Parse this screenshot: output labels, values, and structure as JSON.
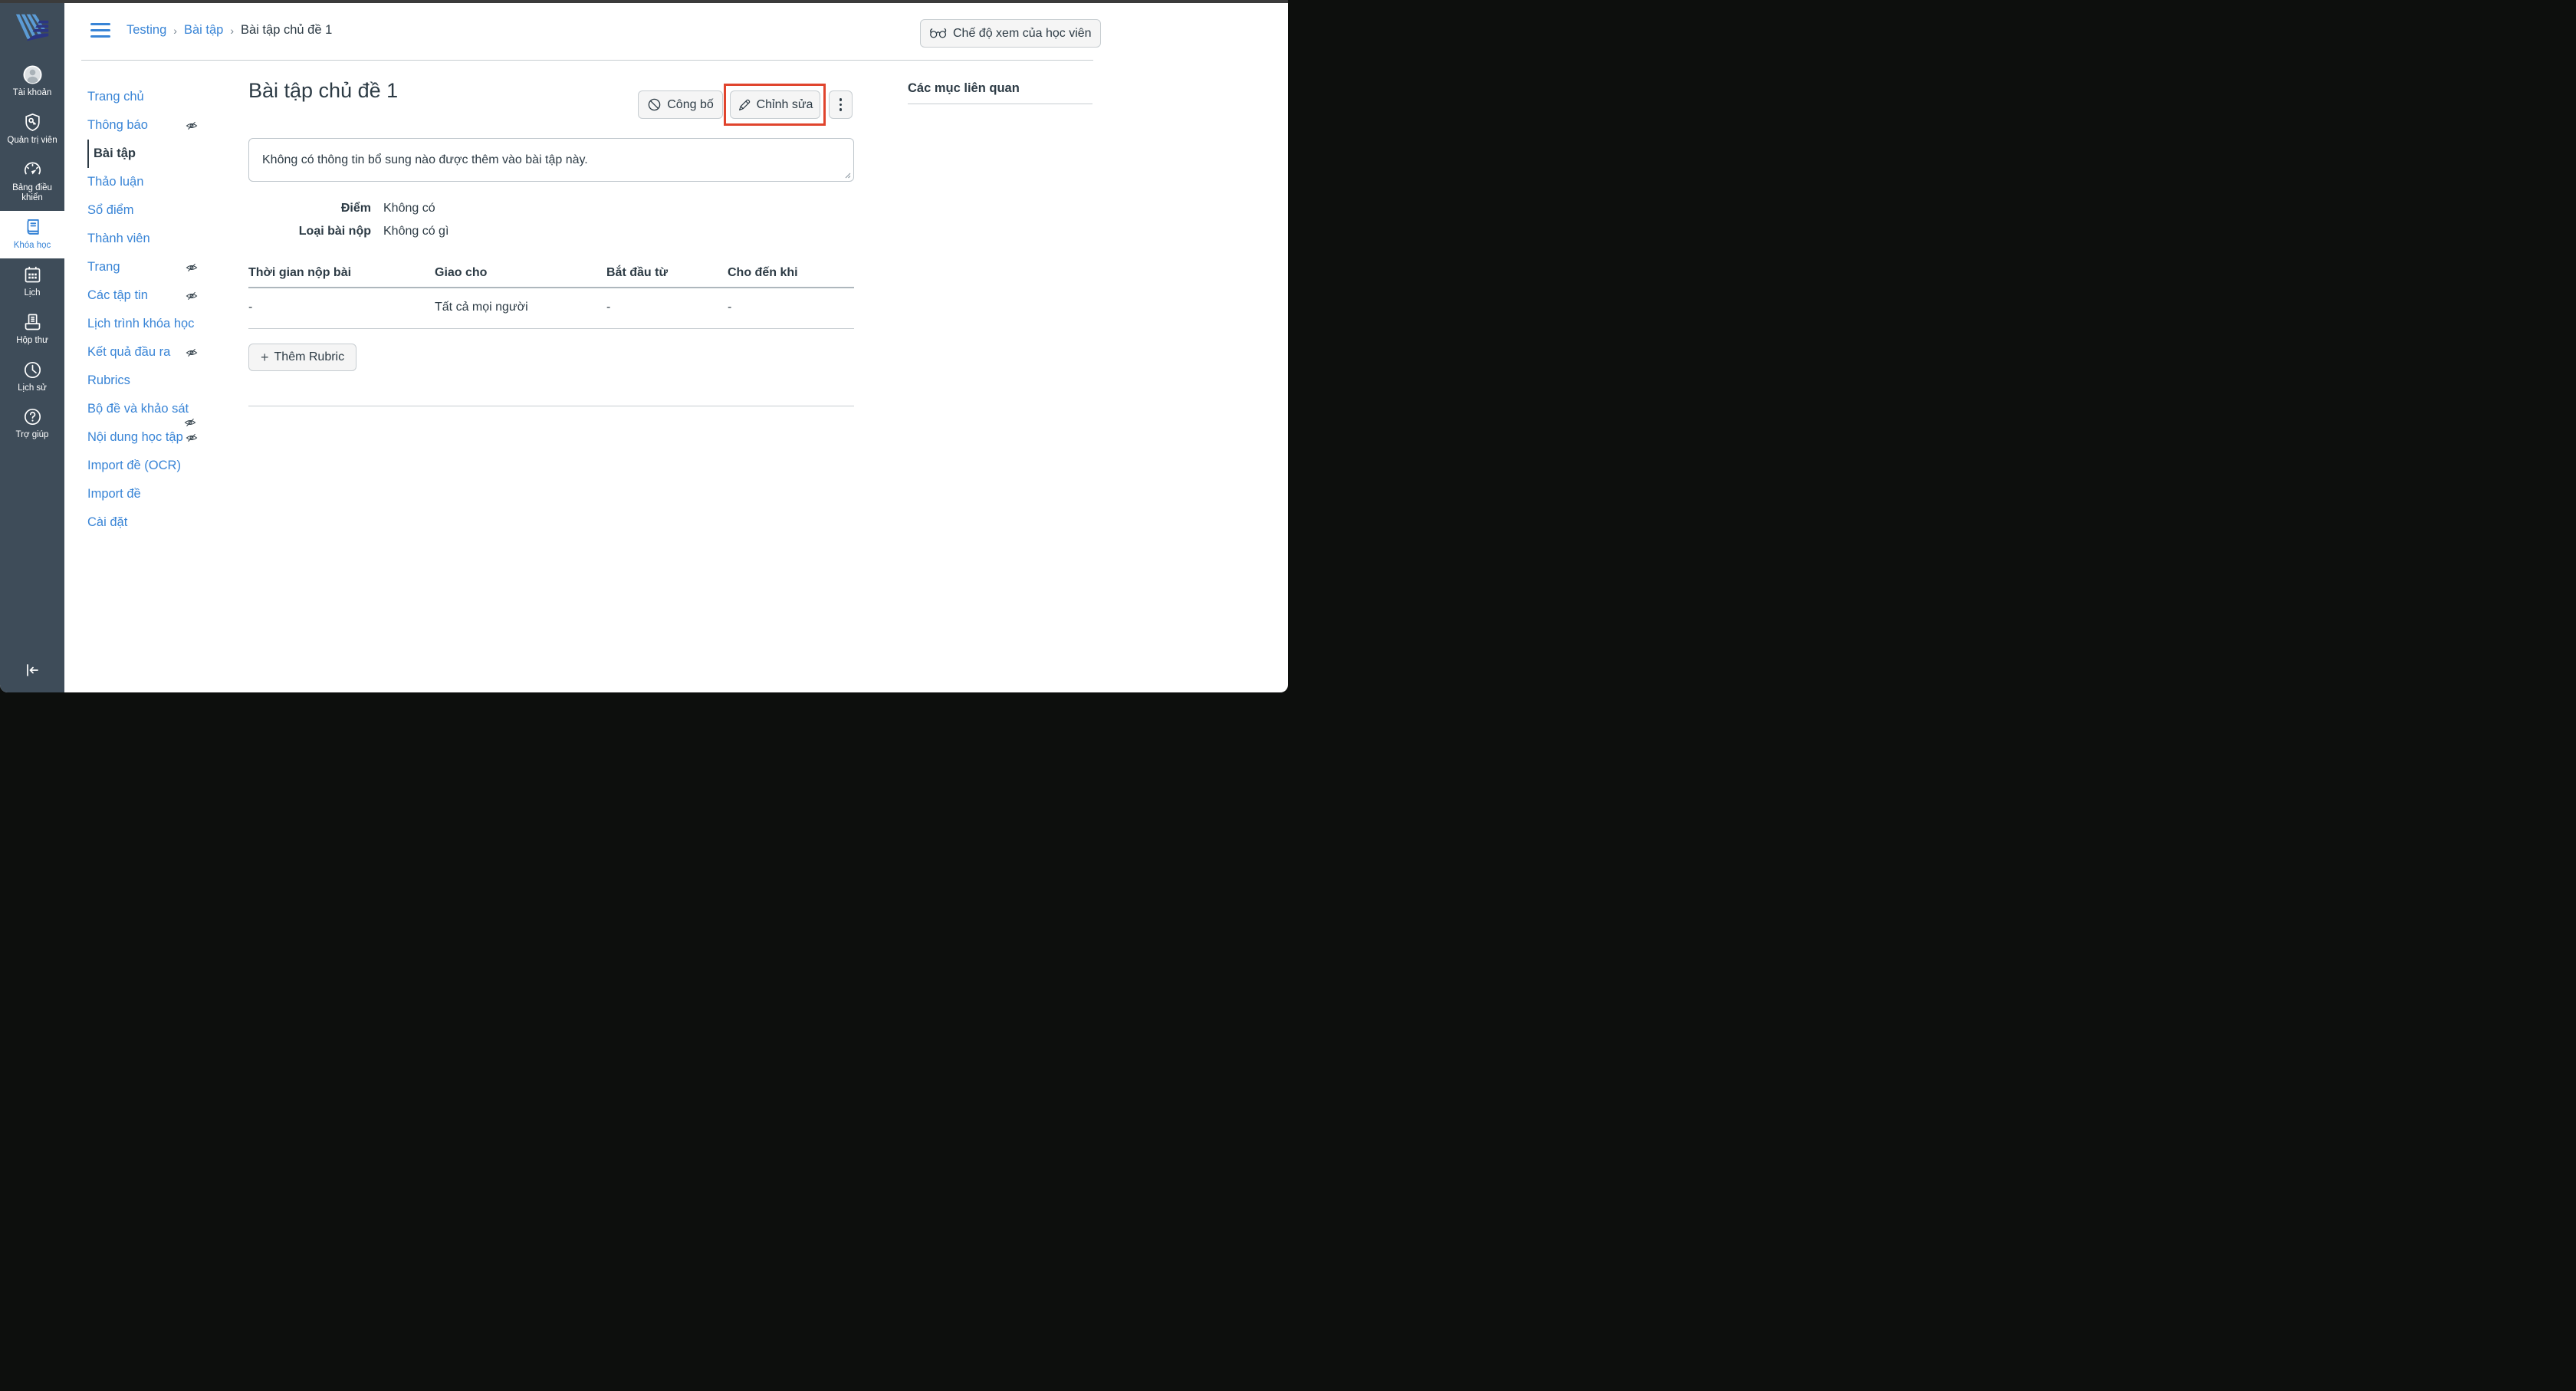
{
  "colors": {
    "accent_blue": "#3884D6",
    "slate": "#2D3B45",
    "sidebar_bg": "#3E4C59",
    "highlight_red": "#E0442D",
    "border_gray": "#C7CDD1"
  },
  "global_nav": {
    "items": [
      {
        "label": "Tài khoản",
        "icon": "avatar"
      },
      {
        "label": "Quản trị viên",
        "icon": "shield-key"
      },
      {
        "label": "Bảng điều khiển",
        "icon": "dashboard-gauge"
      },
      {
        "label": "Khóa học",
        "icon": "book",
        "active": true
      },
      {
        "label": "Lịch",
        "icon": "calendar"
      },
      {
        "label": "Hộp thư",
        "icon": "inbox"
      },
      {
        "label": "Lịch sử",
        "icon": "history-clock"
      },
      {
        "label": "Trợ giúp",
        "icon": "help-circle"
      }
    ],
    "collapse_icon": "collapse-arrow-left"
  },
  "breadcrumb": {
    "items": [
      "Testing",
      "Bài tập",
      "Bài tập chủ đề 1"
    ],
    "separator": "›"
  },
  "header": {
    "student_view_label": "Chế độ xem của học viên",
    "student_view_icon": "glasses"
  },
  "course_nav": {
    "items": [
      {
        "label": "Trang chủ"
      },
      {
        "label": "Thông báo",
        "hidden": true
      },
      {
        "label": "Bài tập",
        "active": true
      },
      {
        "label": "Thảo luận"
      },
      {
        "label": "Sổ điểm"
      },
      {
        "label": "Thành viên"
      },
      {
        "label": "Trang",
        "hidden": true
      },
      {
        "label": "Các tập tin",
        "hidden": true
      },
      {
        "label": "Lịch trình khóa học"
      },
      {
        "label": "Kết quả đầu ra",
        "hidden": true
      },
      {
        "label": "Rubrics"
      },
      {
        "label": "Bộ đề và khảo sát"
      },
      {
        "label": "Nội dung học tập",
        "hidden": true,
        "double_eye": true
      },
      {
        "label": "Import đề (OCR)"
      },
      {
        "label": "Import đề"
      },
      {
        "label": "Cài đặt"
      }
    ]
  },
  "main": {
    "title": "Bài tập chủ đề 1",
    "publish_label": "Công bố",
    "publish_icon": "circle-slash",
    "edit_label": "Chỉnh sửa",
    "edit_icon": "pencil",
    "more_options_icon": "kebab-dots",
    "description": "Không có thông tin bổ sung nào được thêm vào bài tập này.",
    "details": [
      {
        "label": "Điểm",
        "value": "Không có"
      },
      {
        "label": "Loại bài nộp",
        "value": "Không có gì"
      }
    ],
    "table": {
      "headers": [
        "Thời gian nộp bài",
        "Giao cho",
        "Bắt đầu từ",
        "Cho đến khi"
      ],
      "rows": [
        [
          "-",
          "Tất cả mọi người",
          "-",
          "-"
        ]
      ]
    },
    "add_rubric_label": "Thêm Rubric"
  },
  "sidebar_right": {
    "title": "Các mục liên quan"
  }
}
